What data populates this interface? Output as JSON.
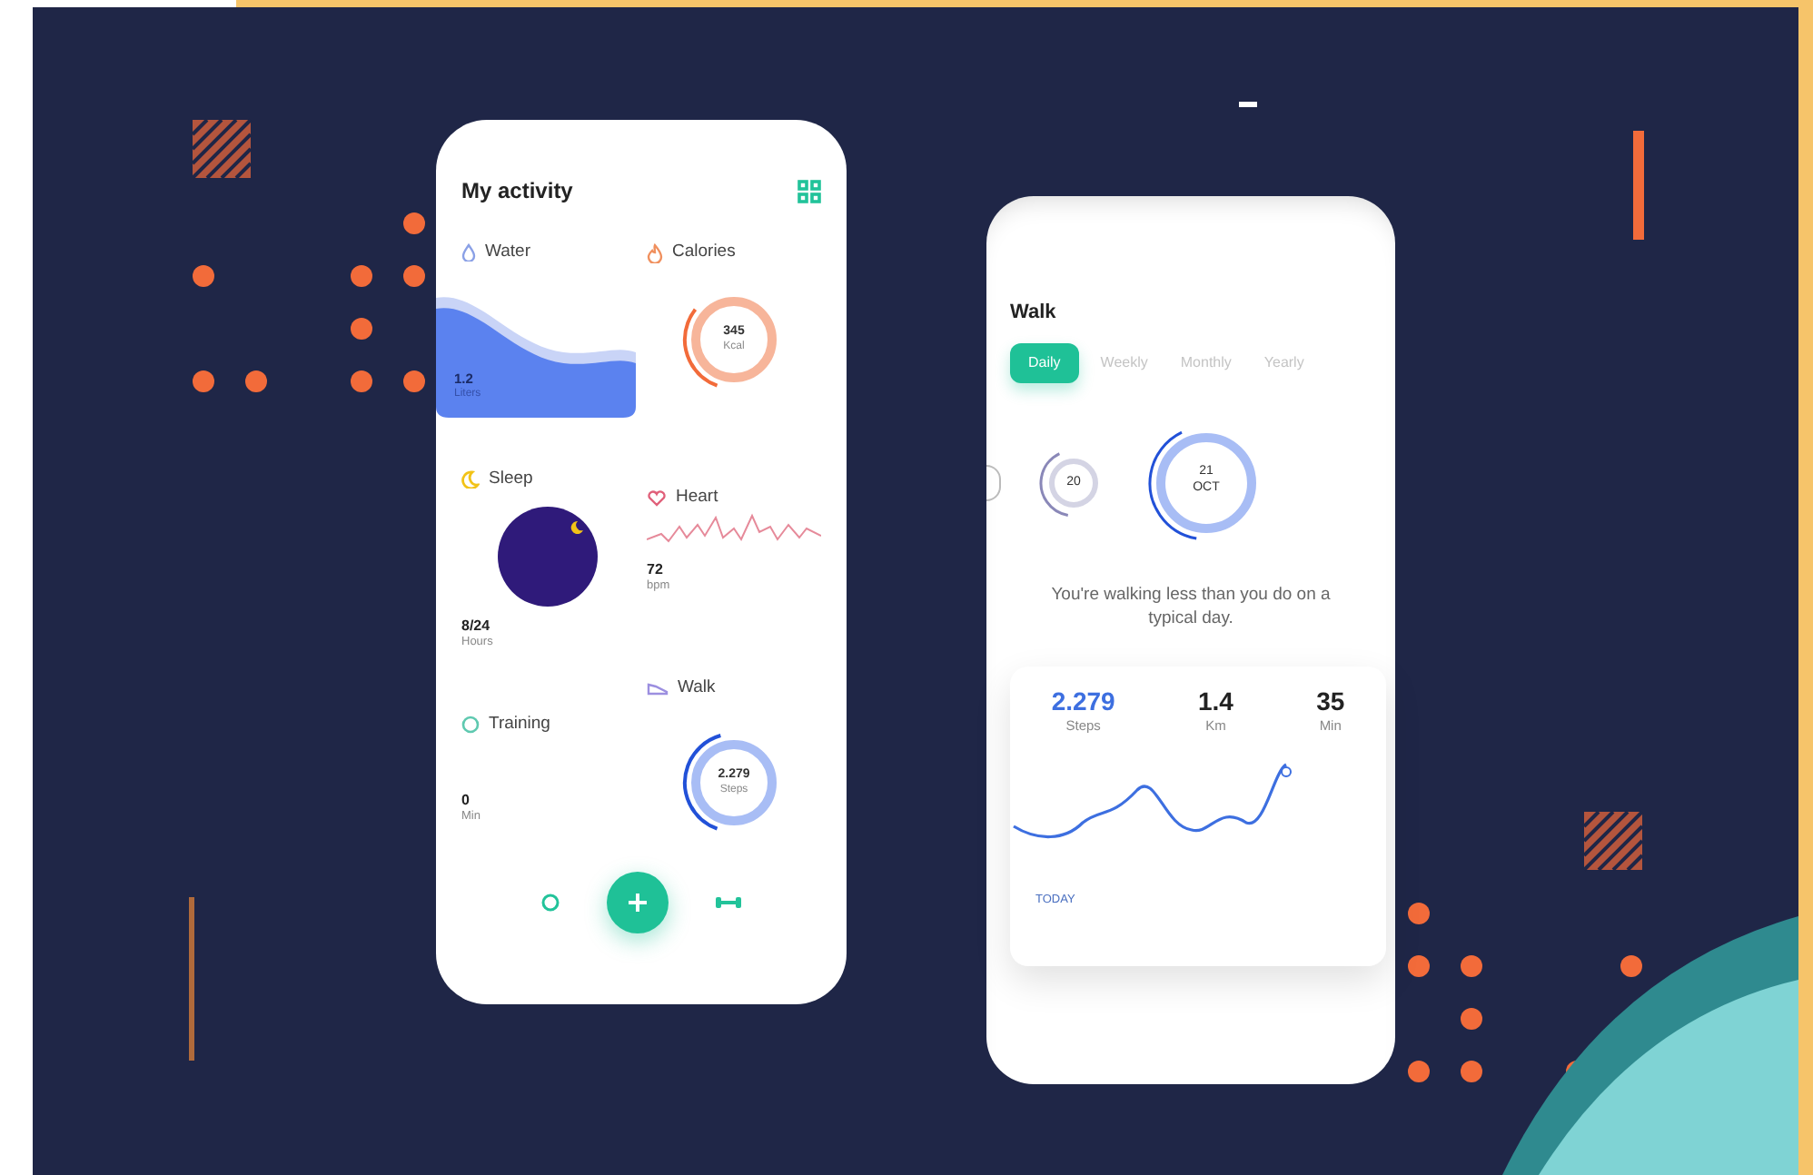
{
  "activity": {
    "title": "My activity",
    "cards": [
      {
        "kind": "water",
        "label": "Water",
        "value": "1.2",
        "unit": "Liters"
      },
      {
        "kind": "sleep",
        "label": "Sleep",
        "value": "8/24",
        "unit": "Hours"
      },
      {
        "kind": "training",
        "label": "Training",
        "value": "0",
        "unit": "Min"
      },
      {
        "kind": "calories",
        "label": "Calories",
        "value": "345",
        "unit": "Kcal",
        "level": 0.3
      },
      {
        "kind": "heart",
        "label": "Heart",
        "value": "72",
        "unit": "bpm"
      },
      {
        "kind": "walk",
        "label": "Walk",
        "value": "2.279",
        "unit": "Steps",
        "level": 0.4
      }
    ]
  },
  "walk": {
    "title": "Walk",
    "tabs": [
      {
        "label": "Daily",
        "selected": true
      },
      {
        "label": "Weekly",
        "selected": false
      },
      {
        "label": "Monthly",
        "selected": false
      },
      {
        "label": "Yearly",
        "selected": false
      }
    ],
    "dates": [
      {
        "day": "20",
        "selected": false
      },
      {
        "day": "21",
        "month": "OCT",
        "selected": true
      }
    ],
    "message": "You're walking less than you do on a typical day.",
    "stats": [
      {
        "value": "2.279",
        "unit": "Steps",
        "selected": true
      },
      {
        "value": "1.4",
        "unit": "Km",
        "selected": false
      },
      {
        "value": "35",
        "unit": "Min",
        "selected": false
      }
    ],
    "chart_footer": "TODAY"
  }
}
